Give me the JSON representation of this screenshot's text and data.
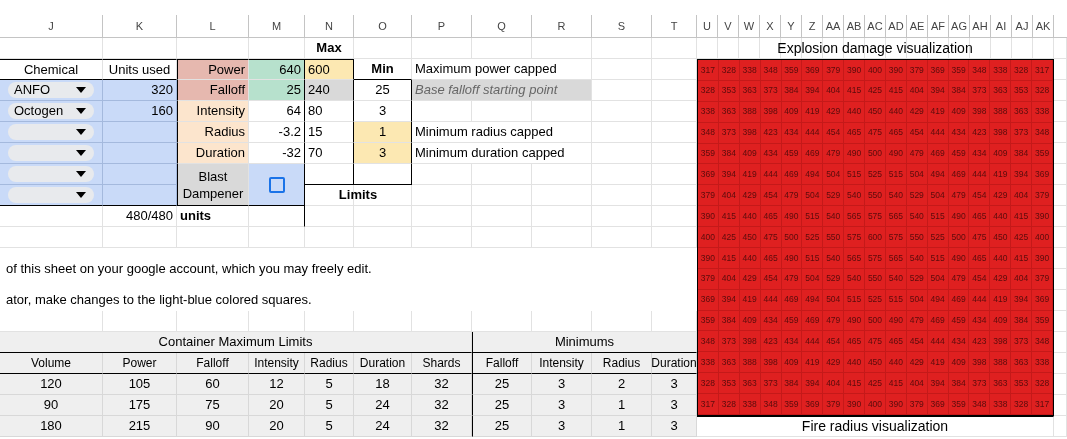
{
  "columns": [
    "J",
    "K",
    "L",
    "M",
    "N",
    "O",
    "P",
    "Q",
    "R",
    "S",
    "T",
    "U",
    "V",
    "W",
    "X",
    "Y",
    "Z",
    "AA",
    "AB",
    "AC",
    "AD",
    "AE",
    "AF",
    "AG",
    "AH",
    "AI",
    "AJ",
    "AK"
  ],
  "max_header": "Max",
  "min_header": "Min",
  "limits_label": "Limits",
  "chemical_header": "Chemical",
  "units_header": "Units used",
  "chemicals": [
    {
      "kind": "dropdown",
      "name": "ANFO",
      "units": "320"
    },
    {
      "kind": "dropdown",
      "name": "Octogen",
      "units": "160"
    },
    {
      "kind": "dropdown"
    },
    {
      "kind": "dropdown"
    },
    {
      "kind": "dropdown"
    },
    {
      "kind": "dropdown"
    }
  ],
  "stats": [
    {
      "label": {
        "text": "Power",
        "kind": "major"
      },
      "value": {
        "text": "640",
        "kind": "highlighted"
      },
      "max": {
        "text": "600",
        "kind": "capped"
      },
      "note": {
        "text": "Maximum power capped",
        "kind": "plain"
      }
    },
    {
      "label": {
        "text": "Falloff",
        "kind": "major"
      },
      "value": {
        "text": "25",
        "kind": "highlighted"
      },
      "max": {
        "text": "240",
        "kind": "base"
      },
      "min": {
        "text": "25",
        "kind": "plain"
      },
      "note": {
        "text": "Base falloff starting point",
        "kind": "hint"
      }
    },
    {
      "label": {
        "text": "Intensity",
        "kind": "minor"
      },
      "value": {
        "text": "64",
        "kind": "plain"
      },
      "max": {
        "text": "80",
        "kind": "plain"
      },
      "min": {
        "text": "3",
        "kind": "plain"
      }
    },
    {
      "label": {
        "text": "Radius",
        "kind": "minor"
      },
      "value": {
        "text": "-3.2",
        "kind": "plain"
      },
      "max": {
        "text": "15",
        "kind": "plain"
      },
      "min": {
        "text": "1",
        "kind": "capped"
      },
      "note": {
        "text": "Minimum radius capped",
        "kind": "plain"
      }
    },
    {
      "label": {
        "text": "Duration",
        "kind": "minor"
      },
      "value": {
        "text": "-32",
        "kind": "plain"
      },
      "max": {
        "text": "70",
        "kind": "plain"
      },
      "min": {
        "text": "3",
        "kind": "capped"
      },
      "note": {
        "text": "Minimum duration capped",
        "kind": "plain"
      }
    }
  ],
  "blast_dampener": {
    "label": "Blast Dampener",
    "checked": false
  },
  "total_units": "480/480",
  "units_label": "units",
  "instructions": [
    "of this sheet on your google account, which you may freely edit.",
    "ator, make changes to the light-blue colored squares."
  ],
  "limits_table": {
    "groups": [
      "Container Maximum Limits",
      "Minimums"
    ],
    "columns": [
      "Volume",
      "Power",
      "Falloff",
      "Intensity",
      "Radius",
      "Duration",
      "Shards",
      "Falloff",
      "Intensity",
      "Radius",
      "Duration"
    ],
    "rows": [
      [
        "120",
        "105",
        "60",
        "12",
        "5",
        "18",
        "32",
        "25",
        "3",
        "2",
        "3"
      ],
      [
        "90",
        "175",
        "75",
        "20",
        "5",
        "24",
        "32",
        "25",
        "3",
        "1",
        "3"
      ],
      [
        "180",
        "215",
        "90",
        "20",
        "5",
        "24",
        "32",
        "25",
        "3",
        "1",
        "3"
      ]
    ]
  },
  "heatmap": {
    "title": "Explosion damage visualization",
    "rows": [
      [
        "317",
        "328",
        "338",
        "348",
        "359",
        "369",
        "379",
        "390",
        "400",
        "390",
        "379",
        "369",
        "359",
        "348",
        "338",
        "328",
        "317"
      ],
      [
        "328",
        "353",
        "363",
        "373",
        "384",
        "394",
        "404",
        "415",
        "425",
        "415",
        "404",
        "394",
        "384",
        "373",
        "363",
        "353",
        "328"
      ],
      [
        "338",
        "363",
        "388",
        "398",
        "409",
        "419",
        "429",
        "440",
        "450",
        "440",
        "429",
        "419",
        "409",
        "398",
        "388",
        "363",
        "338"
      ],
      [
        "348",
        "373",
        "398",
        "423",
        "434",
        "444",
        "454",
        "465",
        "475",
        "465",
        "454",
        "444",
        "434",
        "423",
        "398",
        "373",
        "348"
      ],
      [
        "359",
        "384",
        "409",
        "434",
        "459",
        "469",
        "479",
        "490",
        "500",
        "490",
        "479",
        "469",
        "459",
        "434",
        "409",
        "384",
        "359"
      ],
      [
        "369",
        "394",
        "419",
        "444",
        "469",
        "494",
        "504",
        "515",
        "525",
        "515",
        "504",
        "494",
        "469",
        "444",
        "419",
        "394",
        "369"
      ],
      [
        "379",
        "404",
        "429",
        "454",
        "479",
        "504",
        "529",
        "540",
        "550",
        "540",
        "529",
        "504",
        "479",
        "454",
        "429",
        "404",
        "379"
      ],
      [
        "390",
        "415",
        "440",
        "465",
        "490",
        "515",
        "540",
        "565",
        "575",
        "565",
        "540",
        "515",
        "490",
        "465",
        "440",
        "415",
        "390"
      ],
      [
        "400",
        "425",
        "450",
        "475",
        "500",
        "525",
        "550",
        "575",
        "600",
        "575",
        "550",
        "525",
        "500",
        "475",
        "450",
        "425",
        "400"
      ],
      [
        "390",
        "415",
        "440",
        "465",
        "490",
        "515",
        "540",
        "565",
        "575",
        "565",
        "540",
        "515",
        "490",
        "465",
        "440",
        "415",
        "390"
      ],
      [
        "379",
        "404",
        "429",
        "454",
        "479",
        "504",
        "529",
        "540",
        "550",
        "540",
        "529",
        "504",
        "479",
        "454",
        "429",
        "404",
        "379"
      ],
      [
        "369",
        "394",
        "419",
        "444",
        "469",
        "494",
        "504",
        "515",
        "525",
        "515",
        "504",
        "494",
        "469",
        "444",
        "419",
        "394",
        "369"
      ],
      [
        "359",
        "384",
        "409",
        "434",
        "459",
        "469",
        "479",
        "490",
        "500",
        "490",
        "479",
        "469",
        "459",
        "434",
        "409",
        "384",
        "359"
      ],
      [
        "348",
        "373",
        "398",
        "423",
        "434",
        "444",
        "454",
        "465",
        "475",
        "465",
        "454",
        "444",
        "434",
        "423",
        "398",
        "373",
        "348"
      ],
      [
        "338",
        "363",
        "388",
        "398",
        "409",
        "419",
        "429",
        "440",
        "450",
        "440",
        "429",
        "419",
        "409",
        "398",
        "388",
        "363",
        "338"
      ],
      [
        "328",
        "353",
        "363",
        "373",
        "384",
        "394",
        "404",
        "415",
        "425",
        "415",
        "404",
        "394",
        "384",
        "373",
        "363",
        "353",
        "328"
      ],
      [
        "317",
        "328",
        "338",
        "348",
        "359",
        "369",
        "379",
        "390",
        "400",
        "390",
        "379",
        "369",
        "359",
        "348",
        "338",
        "328",
        "317"
      ]
    ]
  },
  "fire_title": "Fire radius visualization"
}
